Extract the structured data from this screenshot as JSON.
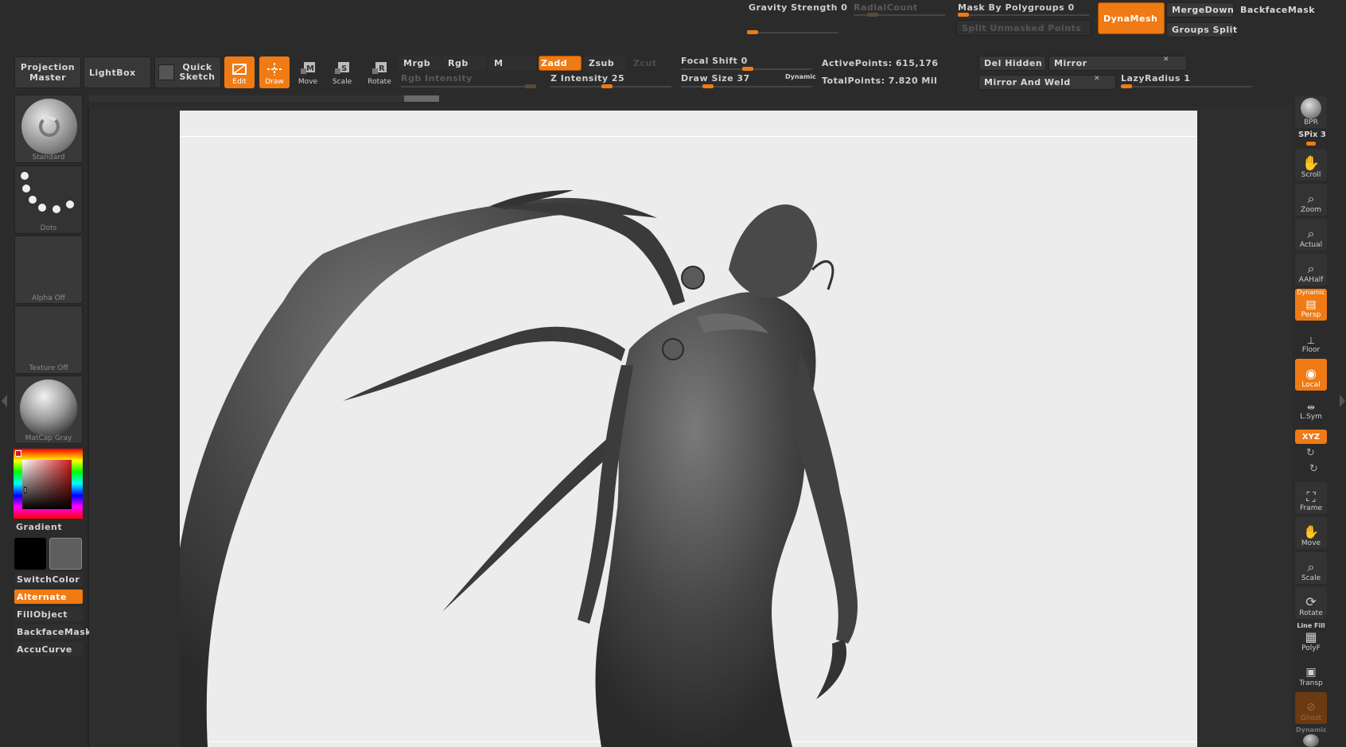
{
  "top_bar": {
    "gravity_strength": "Gravity Strength 0",
    "radial_count": "RadialCount",
    "mask_by_polygroups": "Mask By Polygroups 0",
    "split_unmasked_points": "Split Unmasked Points",
    "dynamesh": "DynaMesh",
    "merge_down": "MergeDown",
    "backface_mask": "BackfaceMask",
    "groups_split": "Groups Split"
  },
  "toolbar": {
    "projection_master": "Projection Master",
    "lightbox": "LightBox",
    "quick_sketch": "Quick Sketch",
    "edit": "Edit",
    "draw": "Draw",
    "move": "Move",
    "scale": "Scale",
    "rotate": "Rotate",
    "mrgb": "Mrgb",
    "rgb": "Rgb",
    "m": "M",
    "zadd": "Zadd",
    "zsub": "Zsub",
    "zcut": "Zcut",
    "rgb_intensity": "Rgb Intensity",
    "z_intensity": "Z Intensity 25",
    "focal_shift": "Focal Shift 0",
    "draw_size": "Draw Size 37",
    "dynamic": "Dynamic",
    "active_points": "ActivePoints: 615,176",
    "total_points": "TotalPoints: 7.820 Mil",
    "del_hidden": "Del Hidden",
    "mirror": "Mirror",
    "mirror_and_weld": "Mirror And Weld",
    "lazy_radius": "LazyRadius 1"
  },
  "left_shelf": {
    "brush": "Standard",
    "stroke": "Dots",
    "alpha": "Alpha  Off",
    "texture": "Texture  Off",
    "material": "MatCap  Gray",
    "gradient": "Gradient",
    "switch_color": "SwitchColor",
    "alternate": "Alternate",
    "fill_object": "FillObject",
    "backface_mask": "BackfaceMask",
    "accu_curve": "AccuCurve"
  },
  "right_shelf": {
    "bpr": "BPR",
    "spix": "SPix 3",
    "scroll": "Scroll",
    "zoom": "Zoom",
    "actual": "Actual",
    "aahalf": "AAHalf",
    "dynamic": "Dynamic",
    "persp": "Persp",
    "floor": "Floor",
    "local": "Local",
    "lsym": "L.Sym",
    "xyz": "XYZ",
    "frame": "Frame",
    "move": "Move",
    "scale": "Scale",
    "rotate": "Rotate",
    "line_fill": "Line Fill",
    "polyf": "PolyF",
    "transp": "Transp",
    "ghost": "Ghost",
    "dynamic2": "Dynamic"
  },
  "colors": {
    "accent": "#f07a13",
    "panel": "#2b2b2b",
    "canvas": "#ececec"
  }
}
